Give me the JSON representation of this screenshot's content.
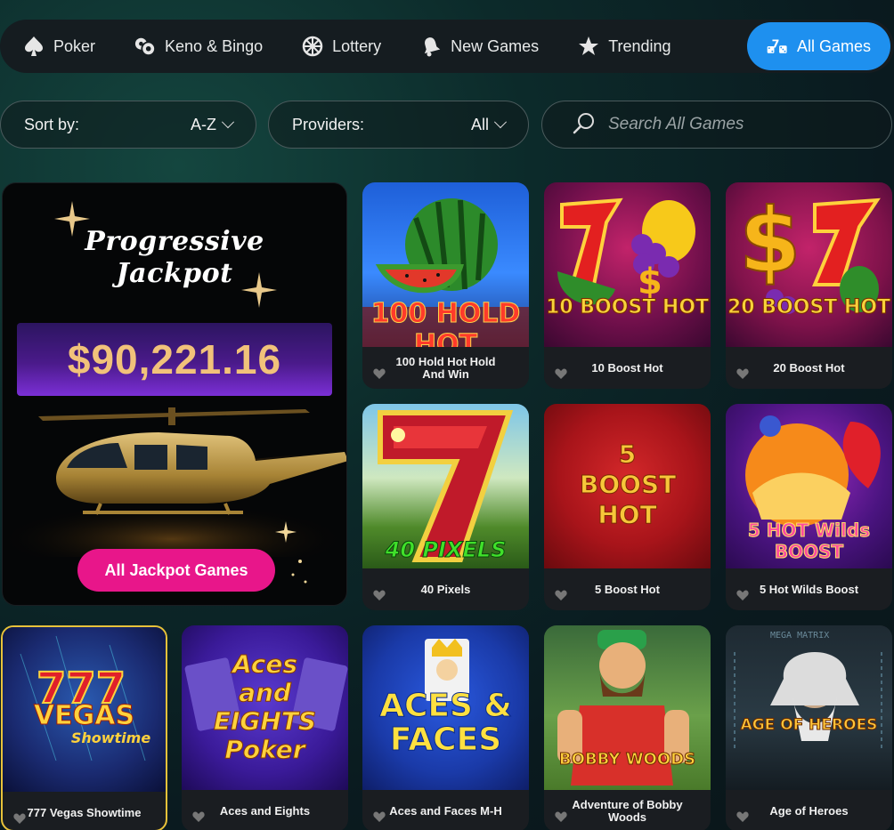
{
  "tabs": [
    {
      "label": "Poker",
      "icon": "spade-icon"
    },
    {
      "label": "Keno & Bingo",
      "icon": "keno-balls-icon"
    },
    {
      "label": "Lottery",
      "icon": "lottery-wheel-icon"
    },
    {
      "label": "New Games",
      "icon": "bell-icon"
    },
    {
      "label": "Trending",
      "icon": "star-icon"
    },
    {
      "label": "All Games",
      "icon": "dice-seven-icon",
      "active": true
    }
  ],
  "filters": {
    "sort_label": "Sort by:",
    "sort_value": "A-Z",
    "providers_label": "Providers:",
    "providers_value": "All",
    "search_placeholder": "Search All Games"
  },
  "jackpot": {
    "title_line1": "Progressive",
    "title_line2": "Jackpot",
    "amount": "$90,221.16",
    "button": "All Jackpot Games"
  },
  "games": [
    {
      "name": "100 Hold Hot Hold And Win",
      "art": "100 HOLD HOT"
    },
    {
      "name": "10 Boost Hot",
      "art": "10 BOOST HOT"
    },
    {
      "name": "20 Boost Hot",
      "art": "20 BOOST HOT"
    },
    {
      "name": "40 Pixels",
      "art": "40 PIXELS"
    },
    {
      "name": "5 Boost Hot",
      "art": "5 BOOST HOT"
    },
    {
      "name": "5 Hot Wilds Boost",
      "art": "5 HOT Wilds BOOST"
    },
    {
      "name": "777 Vegas Showtime",
      "art": "VEGAS"
    },
    {
      "name": "Aces and Eights",
      "art": "Aces and EIGHTS Poker"
    },
    {
      "name": "Aces and Faces M-H",
      "art": "ACES & FACES"
    },
    {
      "name": "Adventure of Bobby Woods",
      "art": "BOBBY WOODS"
    },
    {
      "name": "Age of Heroes",
      "art": "AGE OF HEROES"
    }
  ],
  "colors": {
    "accent": "#1e90ef",
    "jackpot_button": "#e8168a",
    "jackpot_amount": "#f1c27a"
  }
}
